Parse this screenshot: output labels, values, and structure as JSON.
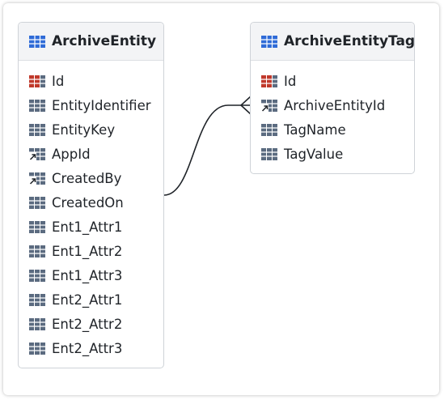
{
  "colors": {
    "table_icon": "#2f6bd7",
    "column_icon": "#5b6b80",
    "key_icon": "#c0392b",
    "fk_arrow": "#1f2328",
    "line": "#1f2328"
  },
  "entities": [
    {
      "title": "ArchiveEntity",
      "icon": "table-icon",
      "fields": [
        {
          "name": "Id",
          "icon": "primary-key-icon"
        },
        {
          "name": "EntityIdentifier",
          "icon": "column-icon"
        },
        {
          "name": "EntityKey",
          "icon": "column-icon"
        },
        {
          "name": "AppId",
          "icon": "foreign-key-icon"
        },
        {
          "name": "CreatedBy",
          "icon": "foreign-key-icon"
        },
        {
          "name": "CreatedOn",
          "icon": "column-icon"
        },
        {
          "name": "Ent1_Attr1",
          "icon": "column-icon"
        },
        {
          "name": "Ent1_Attr2",
          "icon": "column-icon"
        },
        {
          "name": "Ent1_Attr3",
          "icon": "column-icon"
        },
        {
          "name": "Ent2_Attr1",
          "icon": "column-icon"
        },
        {
          "name": "Ent2_Attr2",
          "icon": "column-icon"
        },
        {
          "name": "Ent2_Attr3",
          "icon": "column-icon"
        }
      ]
    },
    {
      "title": "ArchiveEntityTag",
      "icon": "table-icon",
      "fields": [
        {
          "name": "Id",
          "icon": "primary-key-icon"
        },
        {
          "name": "ArchiveEntityId",
          "icon": "foreign-key-icon"
        },
        {
          "name": "TagName",
          "icon": "column-icon"
        },
        {
          "name": "TagValue",
          "icon": "column-icon"
        }
      ]
    }
  ],
  "relationships": [
    {
      "from": "ArchiveEntity",
      "to": "ArchiveEntityTag",
      "to_end": "crow-foot-many"
    }
  ]
}
